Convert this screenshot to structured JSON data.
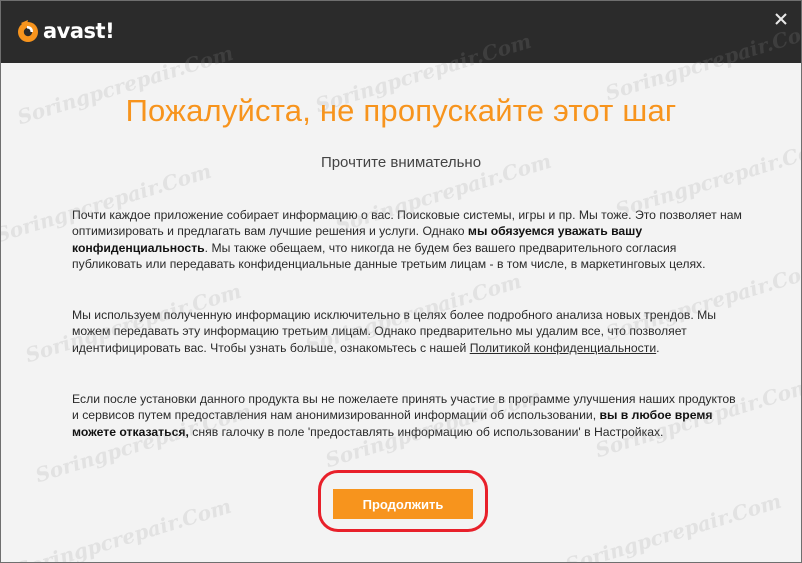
{
  "window": {
    "brand": "avast!",
    "close_symbol": "✕"
  },
  "main": {
    "heading": "Пожалуйста, не пропускайте этот шаг",
    "subheading": "Прочтите внимательно",
    "paragraph1": {
      "part1": "Почти каждое приложение собирает информацию о вас. Поисковые системы, игры и пр. Мы тоже. Это позволяет нам оптимизировать и предлагать вам лучшие решения и услуги. Однако ",
      "bold": "мы обязуемся уважать вашу конфиденциальность",
      "part2": ". Мы также обещаем, что никогда не будем без вашего предварительного согласия публиковать или передавать конфиденциальные данные третьим лицам - в том числе, в маркетинговых целях."
    },
    "paragraph2": {
      "text": "Мы используем полученную информацию исключительно в целях более подробного анализа новых трендов. Мы можем передавать эту информацию третьим лицам. Однако предварительно мы удалим все, что позволяет идентифицировать вас. Чтобы узнать больше, ознакомьтесь с нашей ",
      "link": "Политикой конфиденциальности",
      "end": "."
    },
    "paragraph3": {
      "part1": "Если после установки данного продукта вы не пожелаете принять участие в программе улучшения наших продуктов и сервисов путем предоставления нам анонимизированной информации об использовании, ",
      "bold": "вы в любое время можете отказаться,",
      "part2": " сняв галочку в поле 'предоставлять информацию об использовании' в Настройках."
    },
    "continue_button": "Продолжить"
  },
  "watermark": {
    "text": "Soringpcrepair.Com"
  },
  "colors": {
    "titlebar": "#2b2b2b",
    "accent": "#f7941d",
    "highlight": "#e8202a",
    "background": "#f3f3f3"
  }
}
